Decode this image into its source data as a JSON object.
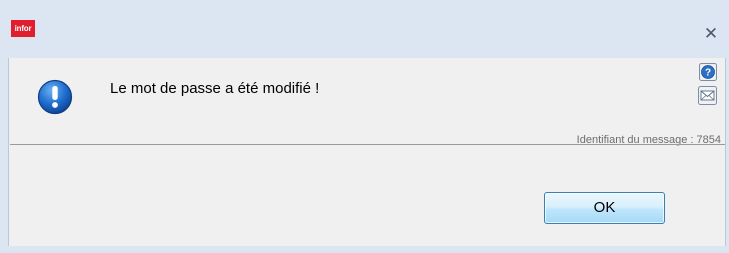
{
  "titlebar": {
    "logo_text": "infor",
    "close_glyph": "✕",
    "brand_color": "#e01e2d"
  },
  "dialog": {
    "message": "Le mot de passe a été modifié !",
    "message_id_text": "Identifiant du message : 7854",
    "icon": "info-icon",
    "ok_label": "OK"
  },
  "actions": {
    "help_icon": "help-icon",
    "mail_icon": "mail-icon"
  }
}
